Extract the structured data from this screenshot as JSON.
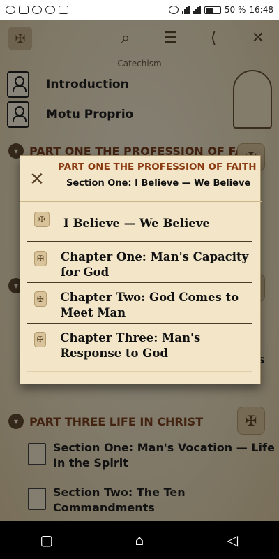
{
  "status_bar": {
    "battery": "50 %",
    "time": "16:48"
  },
  "app_bar": {
    "subtitle": "Catechism",
    "icons": [
      "app-logo-icon",
      "search-icon",
      "sliders-icon",
      "share-icon",
      "crossed-tools-icon"
    ]
  },
  "list": {
    "items": [
      {
        "label": "Introduction"
      },
      {
        "label": "Motu Proprio"
      }
    ]
  },
  "parts": {
    "part_one": "PART ONE THE PROFESSION OF FAITH",
    "part_three": "PART THREE LIFE IN CHRIST",
    "partial_text_right": "s"
  },
  "sections": [
    {
      "label": "Section One: Man's Vocation — Life In the Spirit"
    },
    {
      "label": "Section Two: The Ten Commandments"
    }
  ],
  "dialog": {
    "title": "PART ONE THE PROFESSION OF FAITH",
    "subtitle": "Section One: I Believe — We Believe",
    "items": [
      {
        "label": "I Believe — We Believe"
      },
      {
        "label": "Chapter One: Man's Capacity for God"
      },
      {
        "label": "Chapter Two: God Comes to Meet Man"
      },
      {
        "label": "Chapter Three: Man's Response to God"
      }
    ]
  },
  "nav_bar": {
    "icons": [
      "recent-apps-icon",
      "home-icon",
      "back-icon"
    ]
  }
}
